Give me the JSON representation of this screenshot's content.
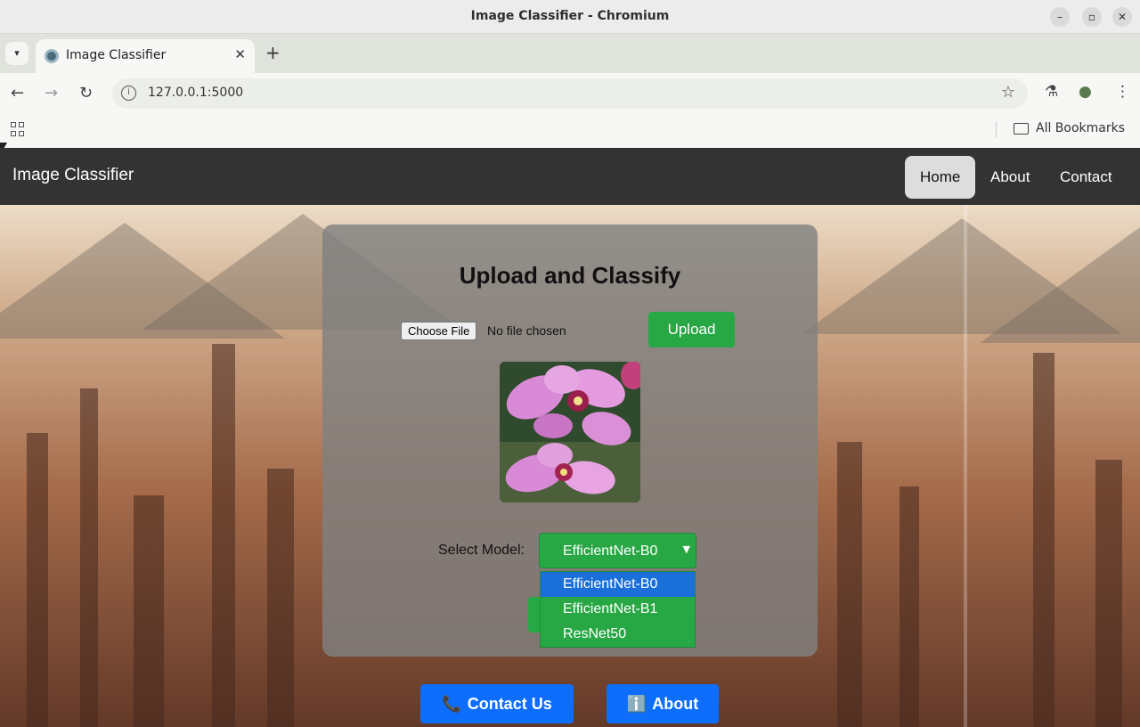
{
  "window": {
    "title": "Image Classifier - Chromium",
    "minimize_icon": "–",
    "maximize_icon": "▫",
    "close_icon": "✕"
  },
  "tab": {
    "title": "Image Classifier",
    "close_icon": "✕",
    "new_tab_icon": "+"
  },
  "toolbar": {
    "back_icon": "←",
    "forward_icon": "→",
    "reload_icon": "↻",
    "url": "127.0.0.1:5000",
    "star_icon": "☆",
    "labs_icon": "⚗",
    "profile_icon": "●",
    "menu_icon": "⋮"
  },
  "bookmarks": {
    "all_bookmarks": "All Bookmarks"
  },
  "navbar": {
    "brand": "Image Classifier",
    "links": [
      "Home",
      "About",
      "Contact"
    ],
    "active": "Home"
  },
  "card": {
    "heading": "Upload and Classify",
    "file_button": "Choose File",
    "file_status": "No file chosen",
    "upload_button": "Upload",
    "model_label": "Select Model:",
    "selected_model": "EfficientNet-B0",
    "options": [
      "EfficientNet-B0",
      "EfficientNet-B1",
      "ResNet50"
    ]
  },
  "footer_buttons": {
    "contact": {
      "icon": "📞",
      "label": "Contact Us"
    },
    "about": {
      "icon": "ℹ️",
      "label": "About"
    }
  },
  "colors": {
    "navbar_bg": "#333333",
    "green": "#28a745",
    "blue": "#0d6efd",
    "option_highlight": "#1a6fd8"
  }
}
